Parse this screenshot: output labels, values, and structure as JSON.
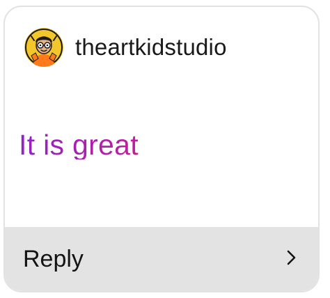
{
  "card": {
    "username": "theartkidstudio",
    "message": "It is great",
    "reply_label": "Reply"
  },
  "icons": {
    "avatar": "cartoon-avatar-icon",
    "chevron": "chevron-right-icon"
  },
  "colors": {
    "message_gradient_start": "#8f23c4",
    "message_gradient_end": "#c01f9e",
    "reply_bar_background": "#e3e3e3",
    "card_border": "#e2e2e2"
  }
}
